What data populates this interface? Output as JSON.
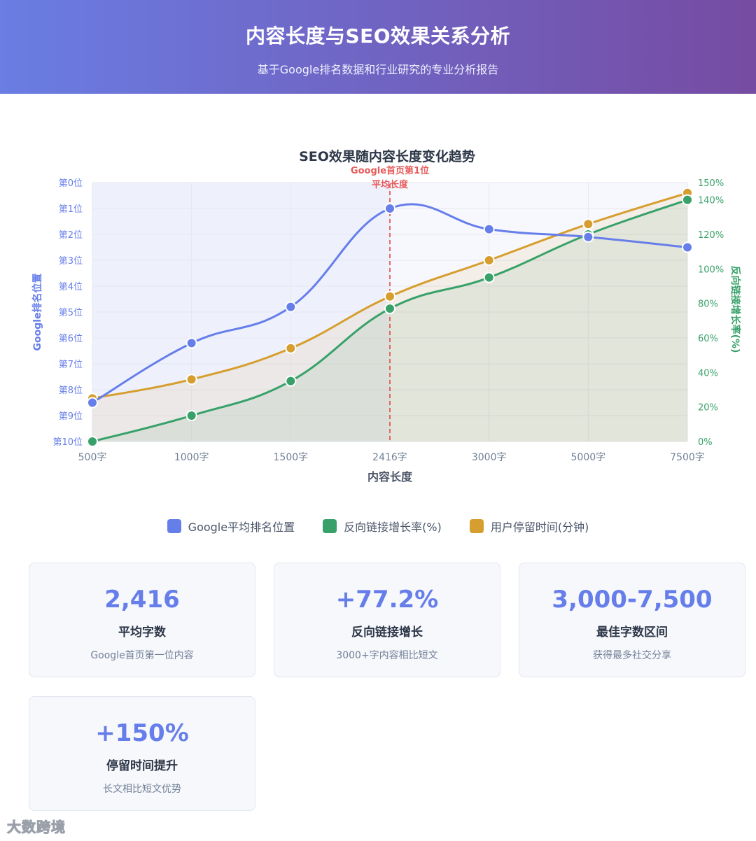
{
  "header": {
    "title": "内容长度与SEO效果关系分析",
    "subtitle": "基于Google排名数据和行业研究的专业分析报告"
  },
  "chart_data": {
    "type": "line",
    "title": "SEO效果随内容长度变化趋势",
    "xlabel": "内容长度",
    "categories": [
      "500字",
      "1000字",
      "1500字",
      "2416字",
      "3000字",
      "5000字",
      "7500字"
    ],
    "y_left": {
      "label": "Google排名位置",
      "ticks": [
        "第0位",
        "第1位",
        "第2位",
        "第3位",
        "第4位",
        "第5位",
        "第6位",
        "第7位",
        "第8位",
        "第9位",
        "第10位"
      ],
      "range": [
        0,
        10
      ],
      "inverted": true
    },
    "y_right": {
      "label": "反向链接增长率(%)",
      "ticks": [
        "0%",
        "20%",
        "40%",
        "60%",
        "80%",
        "100%",
        "120%",
        "140%",
        "150%"
      ],
      "range": [
        0,
        150
      ]
    },
    "series": [
      {
        "name": "Google平均排名位置",
        "axis": "left",
        "color": "#667eea",
        "fill": false,
        "values": [
          8.5,
          6.2,
          4.8,
          1.0,
          1.8,
          2.1,
          2.5
        ]
      },
      {
        "name": "反向链接增长率(%)",
        "axis": "right",
        "color": "#38a169",
        "fill": true,
        "values": [
          0,
          15,
          35,
          77,
          95,
          120,
          140
        ]
      },
      {
        "name": "用户停留时间(分钟)",
        "axis": "right",
        "color": "#d69e2e",
        "fill": true,
        "values": [
          25,
          36,
          54,
          84,
          105,
          126,
          144
        ]
      }
    ],
    "annotation": {
      "category_index": 3,
      "lines": [
        "Google首页第1位",
        "平均长度"
      ],
      "color": "#e53e3e"
    },
    "grid": true
  },
  "legend": [
    {
      "label": "Google平均排名位置",
      "color": "#667eea"
    },
    {
      "label": "反向链接增长率(%)",
      "color": "#38a169"
    },
    {
      "label": "用户停留时间(分钟)",
      "color": "#d69e2e"
    }
  ],
  "cards": [
    {
      "value": "2,416",
      "label": "平均字数",
      "desc": "Google首页第一位内容"
    },
    {
      "value": "+77.2%",
      "label": "反向链接增长",
      "desc": "3000+字内容相比短文"
    },
    {
      "value": "3,000-7,500",
      "label": "最佳字数区间",
      "desc": "获得最多社交分享"
    },
    {
      "value": "+150%",
      "label": "停留时间提升",
      "desc": "长文相比短文优势"
    }
  ],
  "watermark": "大数跨境"
}
